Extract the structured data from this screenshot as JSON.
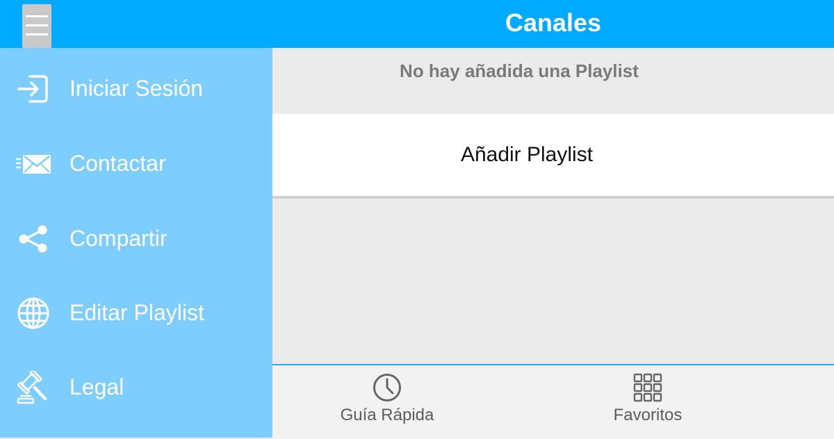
{
  "header": {
    "title": "Canales",
    "menu_icon": "hamburger-menu-icon"
  },
  "sidebar": {
    "items": [
      {
        "label": "Iniciar Sesión",
        "icon": "login-icon"
      },
      {
        "label": "Contactar",
        "icon": "mail-icon"
      },
      {
        "label": "Compartir",
        "icon": "share-icon"
      },
      {
        "label": "Editar Playlist",
        "icon": "globe-icon"
      },
      {
        "label": "Legal",
        "icon": "gavel-icon"
      }
    ]
  },
  "main": {
    "empty_message": "No hay añadida una Playlist",
    "add_playlist_label": "Añadir Playlist"
  },
  "bottom_nav": {
    "tabs": [
      {
        "label": "Guía Rápida",
        "icon": "clock-icon"
      },
      {
        "label": "Favoritos",
        "icon": "grid-icon"
      }
    ]
  },
  "colors": {
    "header": "#00aaff",
    "sidebar": "#7ecdff",
    "content_background": "#ebebeb",
    "bottom_bar_border": "#29a9e8"
  }
}
